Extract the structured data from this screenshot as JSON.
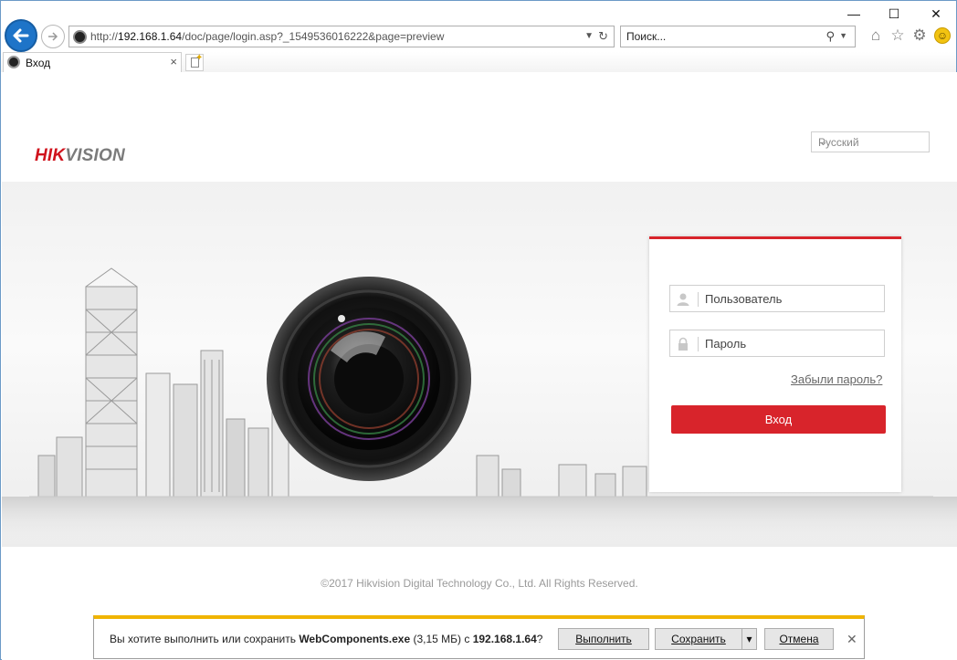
{
  "browser": {
    "url_prefix": "http://",
    "url_host": "192.168.1.64",
    "url_rest": "/doc/page/login.asp?_1549536016222&page=preview",
    "search_placeholder": "Поиск...",
    "tab_title": "Вход",
    "window_controls": {
      "minimize": "—",
      "maximize": "☐",
      "close": "✕"
    },
    "toolbar_icons": [
      "home-icon",
      "star-icon",
      "gear-icon",
      "smiley-icon"
    ]
  },
  "page": {
    "logo": {
      "part1": "HIK",
      "part2": "VISION"
    },
    "language": "Русский",
    "login": {
      "username_placeholder": "Пользователь",
      "password_placeholder": "Пароль",
      "forgot": "Забыли пароль?",
      "submit": "Вход"
    },
    "copyright": "©2017 Hikvision Digital Technology Co., Ltd. All Rights Reserved."
  },
  "download_bar": {
    "text_before": "Вы хотите выполнить или сохранить ",
    "filename": "WebComponents.exe",
    "text_mid": " (3,15 МБ) с ",
    "host": "192.168.1.64",
    "text_after": "?",
    "run": "Выполнить",
    "save": "Сохранить",
    "cancel": "Отмена"
  },
  "colors": {
    "accent_red": "#d8242b",
    "ie_blue": "#1e74c8",
    "notice_yellow": "#f0b400"
  }
}
